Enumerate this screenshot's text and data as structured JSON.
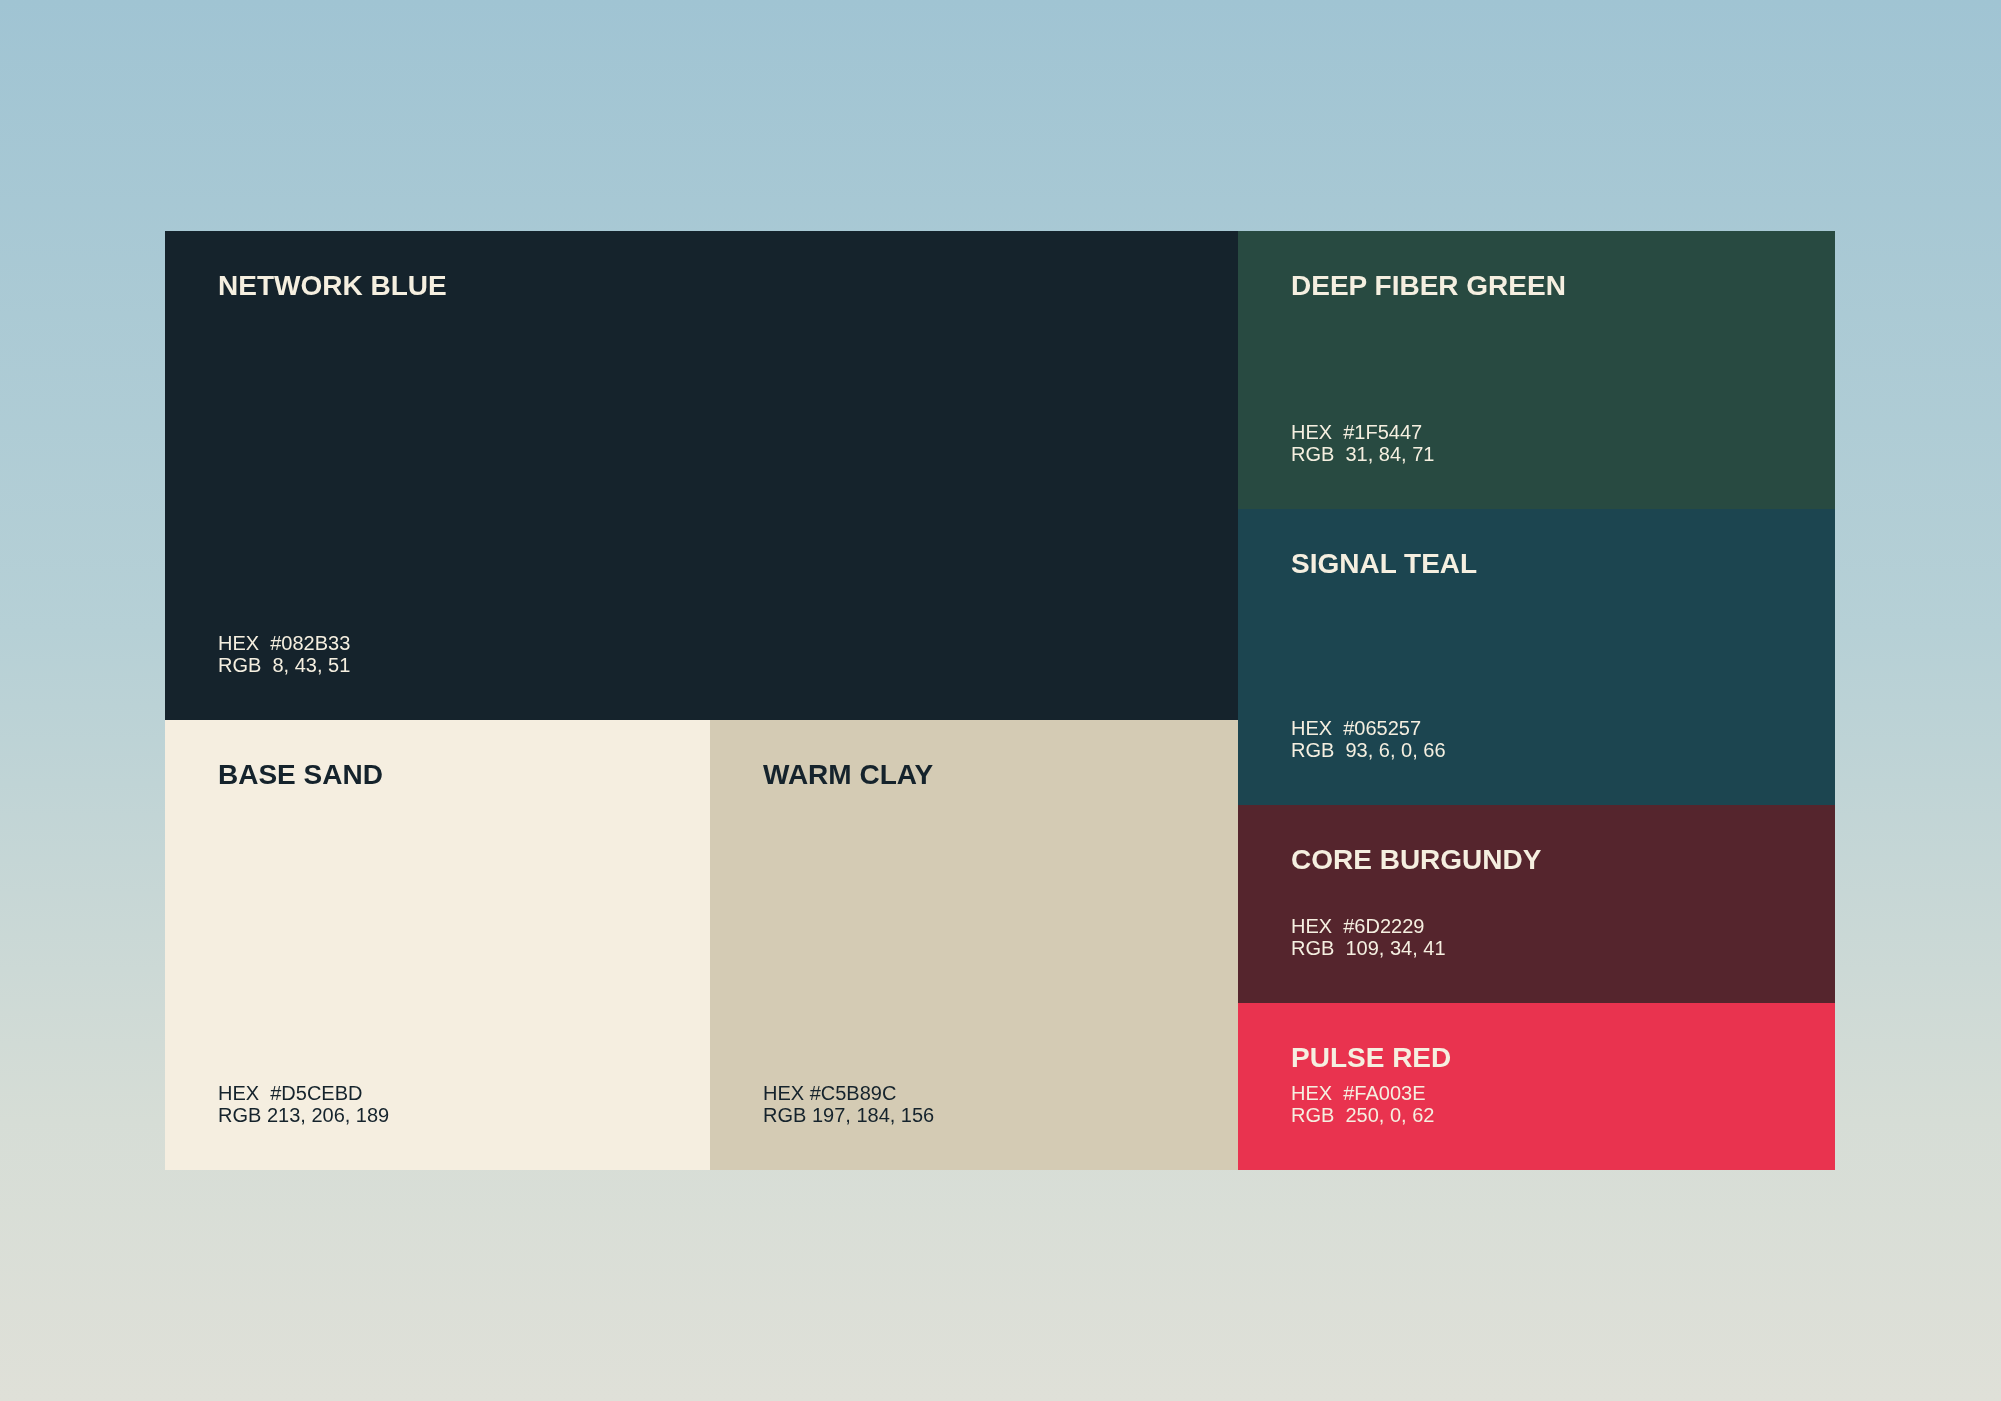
{
  "swatches": [
    {
      "name": "NETWORK BLUE",
      "hex": "HEX  #082B33",
      "rgb": "RGB  8, 43, 51",
      "color": "#15232c"
    },
    {
      "name": "BASE SAND",
      "hex": "HEX  #D5CEBD",
      "rgb": "RGB 213, 206, 189",
      "color": "#f5eee0"
    },
    {
      "name": "WARM CLAY",
      "hex": "HEX #C5B89C",
      "rgb": "RGB 197, 184, 156",
      "color": "#d4cbb4"
    },
    {
      "name": "DEEP FIBER GREEN",
      "hex": "HEX  #1F5447",
      "rgb": "RGB  31, 84, 71",
      "color": "#284a41"
    },
    {
      "name": "SIGNAL TEAL",
      "hex": "HEX  #065257",
      "rgb": "RGB  93, 6, 0, 66",
      "color": "#1c4550"
    },
    {
      "name": "CORE BURGUNDY",
      "hex": "HEX  #6D2229",
      "rgb": "RGB  109, 34, 41",
      "color": "#55252d"
    },
    {
      "name": "PULSE RED",
      "hex": "HEX  #FA003E",
      "rgb": "RGB  250, 0, 62",
      "color": "#e9334f"
    }
  ]
}
